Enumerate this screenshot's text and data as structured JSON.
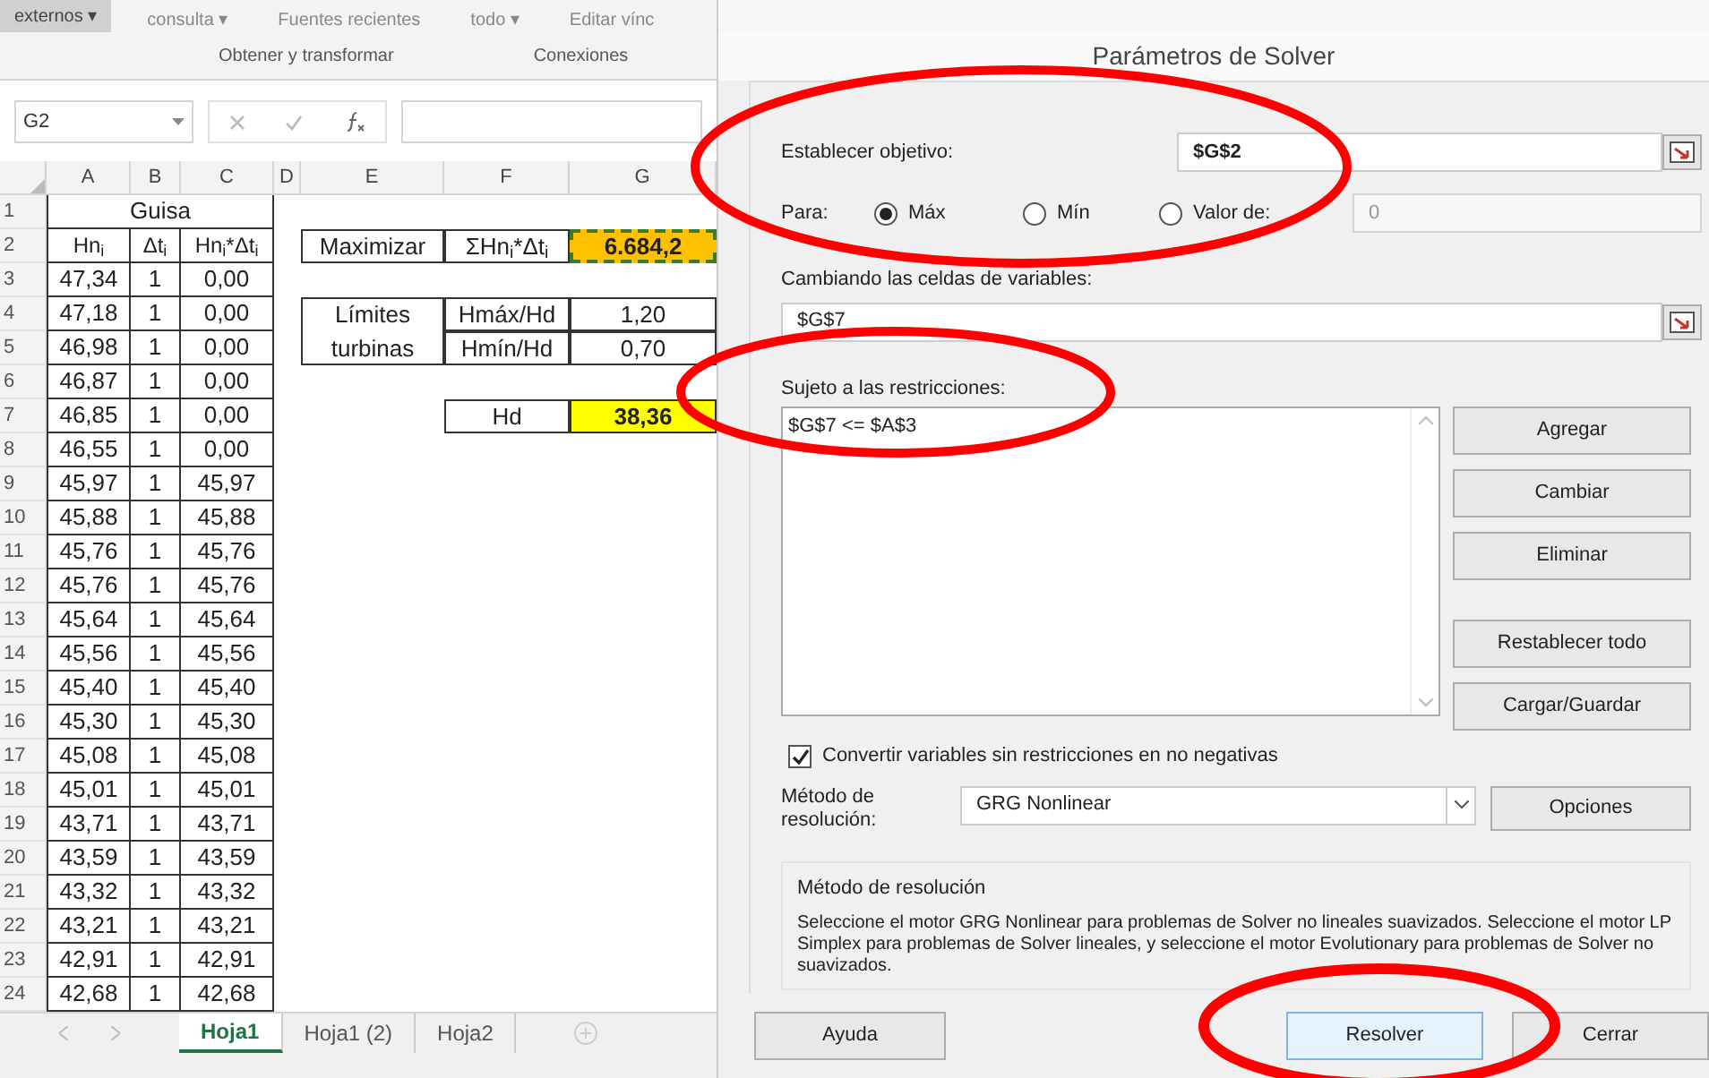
{
  "ribbon": {
    "commands": [
      {
        "label": "externos ▾",
        "pressed": true
      },
      {
        "label": "consulta ▾",
        "pressed": false
      },
      {
        "label": "Fuentes recientes",
        "pressed": false
      },
      {
        "label": "todo ▾",
        "pressed": false
      },
      {
        "label": "Editar vínc",
        "pressed": false
      }
    ],
    "groups": [
      "Obtener y transformar",
      "Conexiones"
    ]
  },
  "formula_bar": {
    "name_box": "G2"
  },
  "sheet": {
    "columns": [
      "A",
      "B",
      "C",
      "D",
      "E",
      "F",
      "G"
    ],
    "row_numbers": [
      "1",
      "2",
      "3",
      "4",
      "5",
      "6",
      "7",
      "8",
      "9",
      "10",
      "11",
      "12",
      "13",
      "14",
      "15",
      "16",
      "17",
      "18",
      "19",
      "20",
      "21",
      "22",
      "23",
      "24"
    ],
    "title": "Guisa",
    "headers": [
      "Hn$_{i}$",
      "Δt$_{i}$",
      "Hn$_{i}$*Δt$_{i}$"
    ],
    "rows": [
      [
        "47,34",
        "1",
        "0,00"
      ],
      [
        "47,18",
        "1",
        "0,00"
      ],
      [
        "46,98",
        "1",
        "0,00"
      ],
      [
        "46,87",
        "1",
        "0,00"
      ],
      [
        "46,85",
        "1",
        "0,00"
      ],
      [
        "46,55",
        "1",
        "0,00"
      ],
      [
        "45,97",
        "1",
        "45,97"
      ],
      [
        "45,88",
        "1",
        "45,88"
      ],
      [
        "45,76",
        "1",
        "45,76"
      ],
      [
        "45,76",
        "1",
        "45,76"
      ],
      [
        "45,64",
        "1",
        "45,64"
      ],
      [
        "45,56",
        "1",
        "45,56"
      ],
      [
        "45,40",
        "1",
        "45,40"
      ],
      [
        "45,30",
        "1",
        "45,30"
      ],
      [
        "45,08",
        "1",
        "45,08"
      ],
      [
        "45,01",
        "1",
        "45,01"
      ],
      [
        "43,71",
        "1",
        "43,71"
      ],
      [
        "43,59",
        "1",
        "43,59"
      ],
      [
        "43,32",
        "1",
        "43,32"
      ],
      [
        "43,21",
        "1",
        "43,21"
      ],
      [
        "42,91",
        "1",
        "42,91"
      ],
      [
        "42,68",
        "1",
        "42,68"
      ]
    ],
    "side_cells": [
      {
        "text": "Maximizar",
        "selected": false
      },
      {
        "text": "ΣHn$_{i}$*Δt$_{i}$",
        "selected": false
      },
      {
        "text": "6.684,2",
        "selected": true,
        "color": "#ffc000"
      },
      {
        "text": "Límites turbinas",
        "selected": false
      },
      {
        "text": "Hmáx/Hd",
        "selected": false
      },
      {
        "text": "1,20",
        "selected": false
      },
      {
        "text": "Hmín/Hd",
        "selected": false
      },
      {
        "text": "0,70",
        "selected": false
      },
      {
        "text": "Hd",
        "selected": false
      },
      {
        "text": "38,36",
        "selected": false,
        "color": "#ffff00"
      }
    ]
  },
  "sheet_tabs": [
    {
      "label": "Hoja1",
      "selected": true
    },
    {
      "label": "Hoja1 (2)",
      "selected": false
    },
    {
      "label": "Hoja2",
      "selected": false
    }
  ],
  "dialog": {
    "title": "Parámetros de Solver",
    "objective_label": "Establecer objetivo:",
    "objective": "$G$2",
    "para_label": "Para:",
    "options": [
      {
        "label": "Máx",
        "selected": true
      },
      {
        "label": "Mín",
        "selected": false
      },
      {
        "label": "Valor de:",
        "selected": false
      }
    ],
    "value_of": "0",
    "changing_label": "Cambiando las celdas de variables:",
    "changing": "$G$7",
    "constraints_label": "Sujeto a las restricciones:",
    "constraints": [
      "$G$7 <= $A$3"
    ],
    "side_buttons": [
      "Agregar",
      "Cambiar",
      "Eliminar",
      "Restablecer todo",
      "Cargar/Guardar"
    ],
    "nonneg": {
      "label": "Convertir variables sin restricciones en no negativas",
      "checked": true
    },
    "method_label": "Método de resolución:",
    "method": "GRG Nonlinear",
    "options_button": "Opciones",
    "group_title": "Método de resolución",
    "group_text": "Seleccione el motor GRG Nonlinear para problemas de Solver no lineales suavizados. Seleccione el motor LP Simplex para problemas de Solver lineales, y seleccione el motor Evolutionary para problemas de Solver no suavizados.",
    "footer_buttons": [
      "Ayuda",
      "Resolver",
      "Cerrar"
    ]
  }
}
